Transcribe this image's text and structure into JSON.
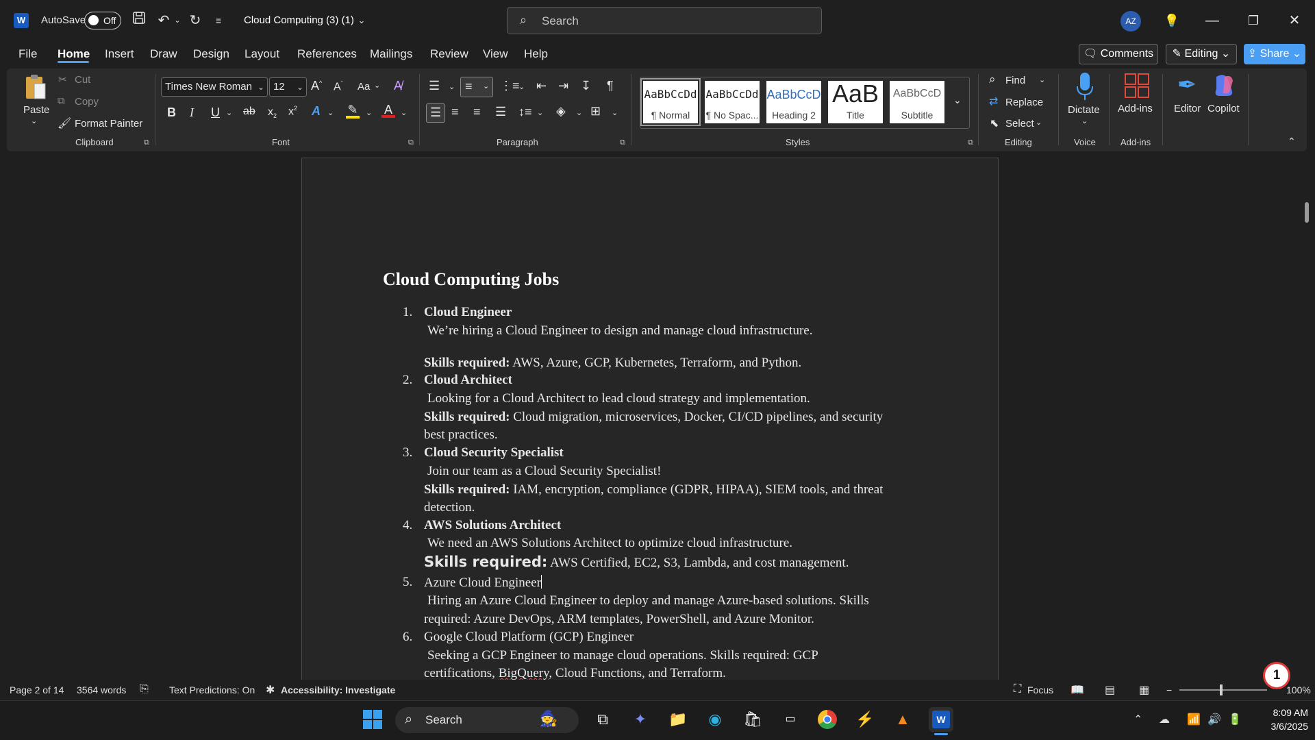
{
  "titlebar": {
    "app_logo": "W",
    "autosave_label": "AutoSave",
    "autosave_state": "Off",
    "doc_title": "Cloud Computing (3) (1)",
    "search_placeholder": "Search",
    "avatar_initials": "AZ"
  },
  "menu": {
    "tabs": [
      "File",
      "Home",
      "Insert",
      "Draw",
      "Design",
      "Layout",
      "References",
      "Mailings",
      "Review",
      "View",
      "Help"
    ],
    "active_tab": "Home",
    "comments_label": "Comments",
    "editing_label": "Editing",
    "share_label": "Share"
  },
  "ribbon": {
    "clipboard": {
      "label": "Clipboard",
      "paste": "Paste",
      "cut": "Cut",
      "copy": "Copy",
      "format_painter": "Format Painter"
    },
    "font": {
      "label": "Font",
      "font_name": "Times New Roman",
      "font_size": "12",
      "change_case": "Aa"
    },
    "paragraph": {
      "label": "Paragraph"
    },
    "styles": {
      "label": "Styles",
      "items": [
        {
          "sample": "AaBbCcDd",
          "name": "¶ Normal"
        },
        {
          "sample": "AaBbCcDd",
          "name": "¶ No Spac..."
        },
        {
          "sample": "AaBbCcD",
          "name": "Heading 2"
        },
        {
          "sample": "AaB",
          "name": "Title"
        },
        {
          "sample": "AaBbCcD",
          "name": "Subtitle"
        }
      ]
    },
    "editing": {
      "label": "Editing",
      "find": "Find",
      "replace": "Replace",
      "select": "Select"
    },
    "voice": {
      "label": "Voice",
      "dictate": "Dictate"
    },
    "addins": {
      "label": "Add-ins",
      "addins_btn": "Add-ins",
      "editor": "Editor",
      "copilot": "Copilot"
    }
  },
  "document": {
    "title": "Cloud Computing Jobs",
    "jobs": [
      {
        "num": "1.",
        "title": "Cloud Engineer",
        "desc": "We’re hiring a Cloud Engineer to design and manage cloud infrastructure.",
        "skills_label": "Skills required:",
        "skills": "AWS, Azure, GCP, Kubernetes, Terraform, and Python."
      },
      {
        "num": "2.",
        "title": "Cloud Architect",
        "desc": "Looking for a Cloud Architect to lead cloud strategy and implementation.",
        "skills_label": "Skills required:",
        "skills_line1": "Cloud migration, microservices, Docker, CI/CD pipelines, and security",
        "skills_line2": "best practices."
      },
      {
        "num": "3.",
        "title": "Cloud Security Specialist",
        "desc": "Join our team as a Cloud Security Specialist!",
        "skills_label": "Skills required:",
        "skills_line1": "IAM, encryption, compliance (GDPR, HIPAA), SIEM tools, and threat",
        "skills_line2": "detection."
      },
      {
        "num": "4.",
        "title": "AWS Solutions Architect",
        "desc": "We need an AWS Solutions Architect to optimize cloud infrastructure.",
        "skills_label": "Skills required:",
        "skills": "AWS Certified, EC2, S3, Lambda, and cost management."
      },
      {
        "num": "5.",
        "title": "Azure Cloud Engineer",
        "desc_line1": "Hiring an Azure Cloud Engineer to deploy and manage Azure-based solutions. Skills",
        "desc_line2": "required: Azure DevOps, ARM templates, PowerShell, and Azure Monitor."
      },
      {
        "num": "6.",
        "title": "Google Cloud Platform (GCP) Engineer",
        "desc_line1": "Seeking a GCP Engineer to manage cloud operations. Skills required: GCP",
        "desc_line2_a": "certifications, ",
        "desc_line2_b": "BigQuery",
        "desc_line2_c": ", Cloud Functions, and Terraform."
      }
    ]
  },
  "statusbar": {
    "page": "Page 2 of 14",
    "words": "3564 words",
    "text_predictions": "Text Predictions: On",
    "accessibility": "Accessibility: Investigate",
    "focus": "Focus",
    "zoom": "100%",
    "notification_count": "1"
  },
  "taskbar": {
    "search_placeholder": "Search",
    "time": "8:09 AM",
    "date": "3/6/2025"
  },
  "colors": {
    "accent": "#4aa0f5",
    "share_button": "#4a9ff5",
    "word_blue": "#185abd",
    "page_bg": "#262626"
  }
}
